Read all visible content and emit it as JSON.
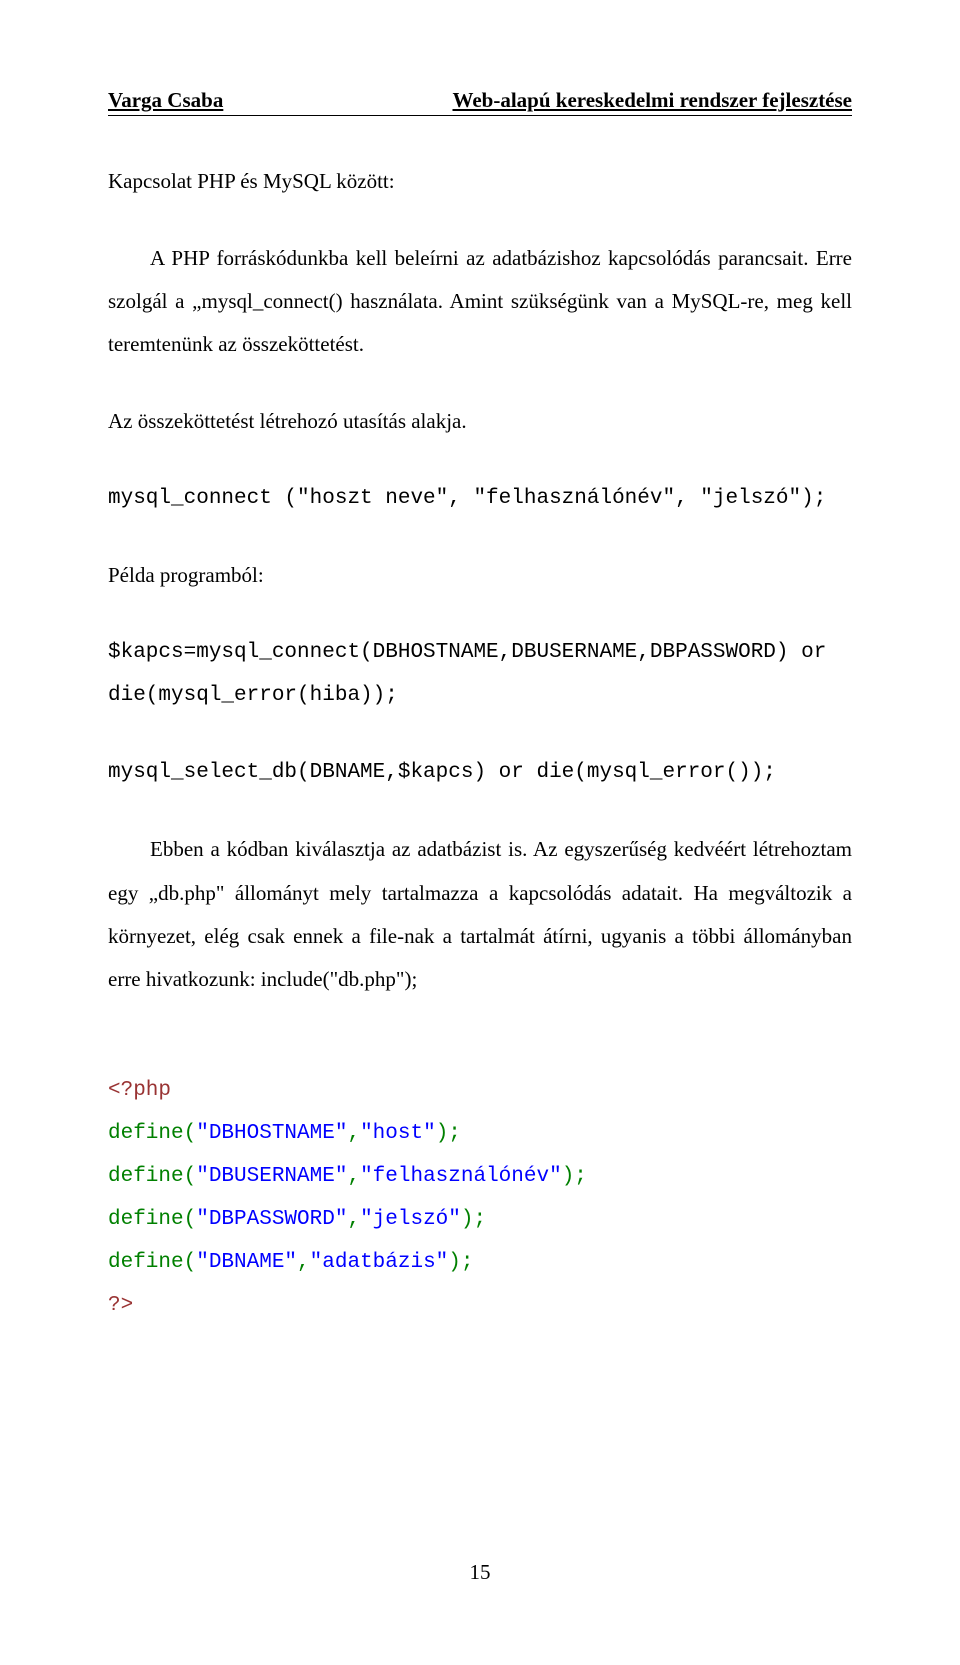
{
  "header": {
    "author": "Varga Csaba",
    "title": "Web-alapú kereskedelmi rendszer fejlesztése"
  },
  "section_title": "Kapcsolat PHP és MySQL között:",
  "para1": "A PHP forráskódunkba kell beleírni az adatbázishoz kapcsolódás parancsait. Erre szolgál a „mysql_connect() használata. Amint szükségünk van a MySQL-re, meg kell teremtenünk az összeköttetést.",
  "line1": "Az összeköttetést létrehozó utasítás alakja.",
  "code1": "mysql_connect (\"hoszt neve\", \"felhasználónév\", \"jelszó\");",
  "line2": "Példa programból:",
  "code2_line1": "$kapcs=mysql_connect(DBHOSTNAME,DBUSERNAME,DBPASSWORD) or",
  "code2_line2": "die(mysql_error(hiba));",
  "code3": "mysql_select_db(DBNAME,$kapcs) or die(mysql_error());",
  "para2": "Ebben a kódban kiválasztja az adatbázist is. Az egyszerűség kedvéért létrehoztam egy „db.php\" állományt mely tartalmazza a kapcsolódás adatait. Ha megváltozik a környezet, elég csak ennek a file-nak a tartalmát átírni, ugyanis a többi állományban erre hivatkozunk: include(\"db.php\");",
  "php_open": "<?php",
  "php_l1_a": "define(",
  "php_l1_b": "\"DBHOSTNAME\"",
  "php_l1_c": ",",
  "php_l1_d": "\"host\"",
  "php_l1_e": ");",
  "php_l2_a": "define(",
  "php_l2_b": "\"DBUSERNAME\"",
  "php_l2_c": ",",
  "php_l2_d": "\"felhasználónév\"",
  "php_l2_e": ");",
  "php_l3_a": "define(",
  "php_l3_b": "\"DBPASSWORD\"",
  "php_l3_c": ",",
  "php_l3_d": "\"jelszó\"",
  "php_l3_e": ");",
  "php_l4_a": "define(",
  "php_l4_b": "\"DBNAME\"",
  "php_l4_c": ",",
  "php_l4_d": "\"adatbázis\"",
  "php_l4_e": ");",
  "php_close": "?>",
  "page_number": "15"
}
